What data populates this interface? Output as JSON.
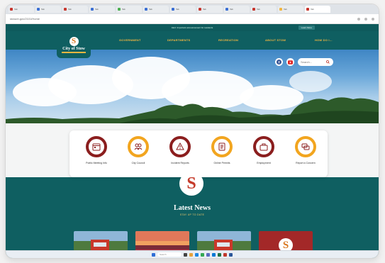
{
  "browser": {
    "tabs": [
      {
        "label": "Tab",
        "color": "#c7372f"
      },
      {
        "label": "Tab",
        "color": "#3b6fd4"
      },
      {
        "label": "Tab",
        "color": "#c7372f"
      },
      {
        "label": "Tab",
        "color": "#3b6fd4"
      },
      {
        "label": "Tab",
        "color": "#4caf50"
      },
      {
        "label": "Tab",
        "color": "#3b6fd4"
      },
      {
        "label": "Tab",
        "color": "#3b6fd4"
      },
      {
        "label": "Tab",
        "color": "#c7372f"
      },
      {
        "label": "Tab",
        "color": "#3b6fd4"
      },
      {
        "label": "Tab",
        "color": "#c7372f"
      },
      {
        "label": "Tab",
        "color": "#f2b640"
      },
      {
        "label": "Tab",
        "color": "#c7372f"
      }
    ],
    "url": "stowoh.gov/2101/Home"
  },
  "site": {
    "alert_text": "Alert: Important announcement for residents",
    "alert_button": "Learn More",
    "logo_text": "City of Stow",
    "nav": {
      "government": "GOVERNMENT",
      "departments": "DEPARTMENTS",
      "recreation": "RECREATION",
      "about": "ABOUT STOW",
      "how_do_i": "HOW DO I..."
    },
    "search_placeholder": "Search...",
    "quick_links": [
      {
        "label": "Public Meeting Info",
        "ring": "#8b1e1e"
      },
      {
        "label": "City Council",
        "ring": "#f2a51f"
      },
      {
        "label": "Incident Reports",
        "ring": "#8b1e1e"
      },
      {
        "label": "Online Permits",
        "ring": "#f2a51f"
      },
      {
        "label": "Employment",
        "ring": "#8b1e1e"
      },
      {
        "label": "Report a Concern",
        "ring": "#f2a51f"
      }
    ],
    "news": {
      "title": "Latest News",
      "subtitle": "STAY UP TO DATE"
    }
  },
  "taskbar": {
    "search": "Search"
  },
  "colors": {
    "teal": "#0f5f61",
    "gold": "#f2b640",
    "maroon": "#8b1e1e"
  }
}
